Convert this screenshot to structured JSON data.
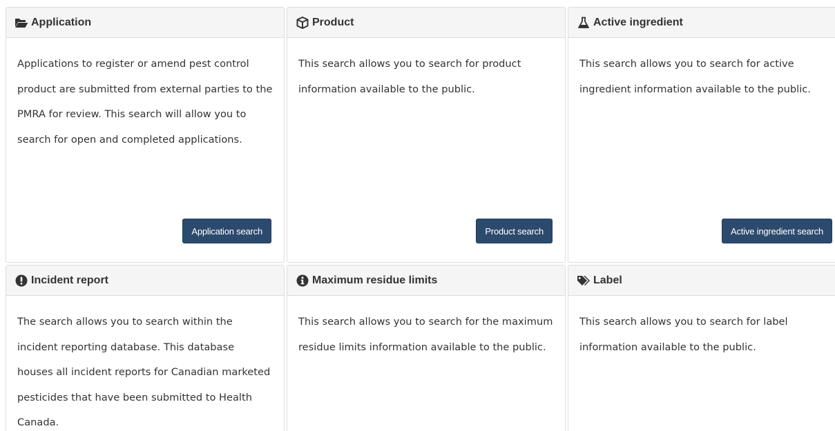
{
  "panels": [
    {
      "icon": "folder-open-icon",
      "title": "Application",
      "description": "Applications to register or amend pest control product are submitted from external parties to the PMRA for review. This search will allow you to search for open and completed applications.",
      "button": "Application search"
    },
    {
      "icon": "cube-icon",
      "title": "Product",
      "description": "This search allows you to search for product information available to the public.",
      "button": "Product search"
    },
    {
      "icon": "flask-icon",
      "title": "Active ingredient",
      "description": "This search allows you to search for active ingredient information available to the public.",
      "button": "Active ingredient search"
    },
    {
      "icon": "exclamation-circle-icon",
      "title": "Incident report",
      "description": "The search allows you to search within the incident reporting database. This database houses all incident reports for Canadian marketed pesticides that have been submitted to Health Canada."
    },
    {
      "icon": "info-circle-icon",
      "title": "Maximum residue limits",
      "description": "This search allows you to search for the maximum residue limits information available to the public."
    },
    {
      "icon": "tags-icon",
      "title": "Label",
      "description": "This search allows you to search for label information available to the public."
    }
  ]
}
